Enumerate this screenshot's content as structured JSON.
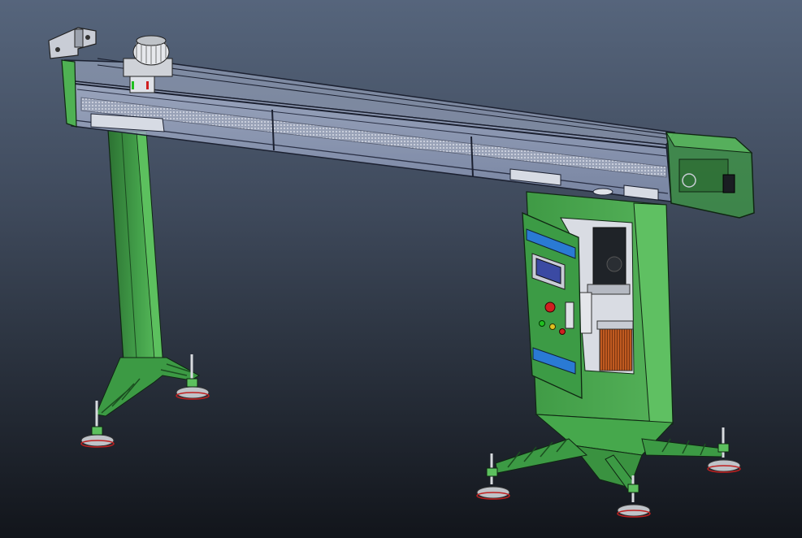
{
  "viewport": {
    "background_top": "#56657c",
    "background_bottom": "#12151b"
  },
  "model": {
    "colors": {
      "frame_green": "#3f9a45",
      "frame_green_light": "#5cc05e",
      "frame_green_dark": "#2c7132",
      "frame_edge": "#0f2612",
      "beam_glass": "#9aa7c6",
      "beam_edge": "#1b2030",
      "door_panel": "#3c9b45",
      "blue_strip": "#2a7ad4",
      "screen_frame": "#c8ccd6",
      "screen": "#3b4aa3",
      "button_red": "#d02020",
      "button_yellow": "#e0c020",
      "heat_sink": "#c05a20",
      "foot_metal": "#bfc3c8",
      "foot_red": "#c02020",
      "motor_gray": "#cfd2d8"
    },
    "parts": [
      "horizontal-beam",
      "left-support-leg",
      "right-cabinet",
      "control-door",
      "end-cap",
      "motor-unit",
      "mounting-bracket",
      "leveling-feet"
    ]
  }
}
